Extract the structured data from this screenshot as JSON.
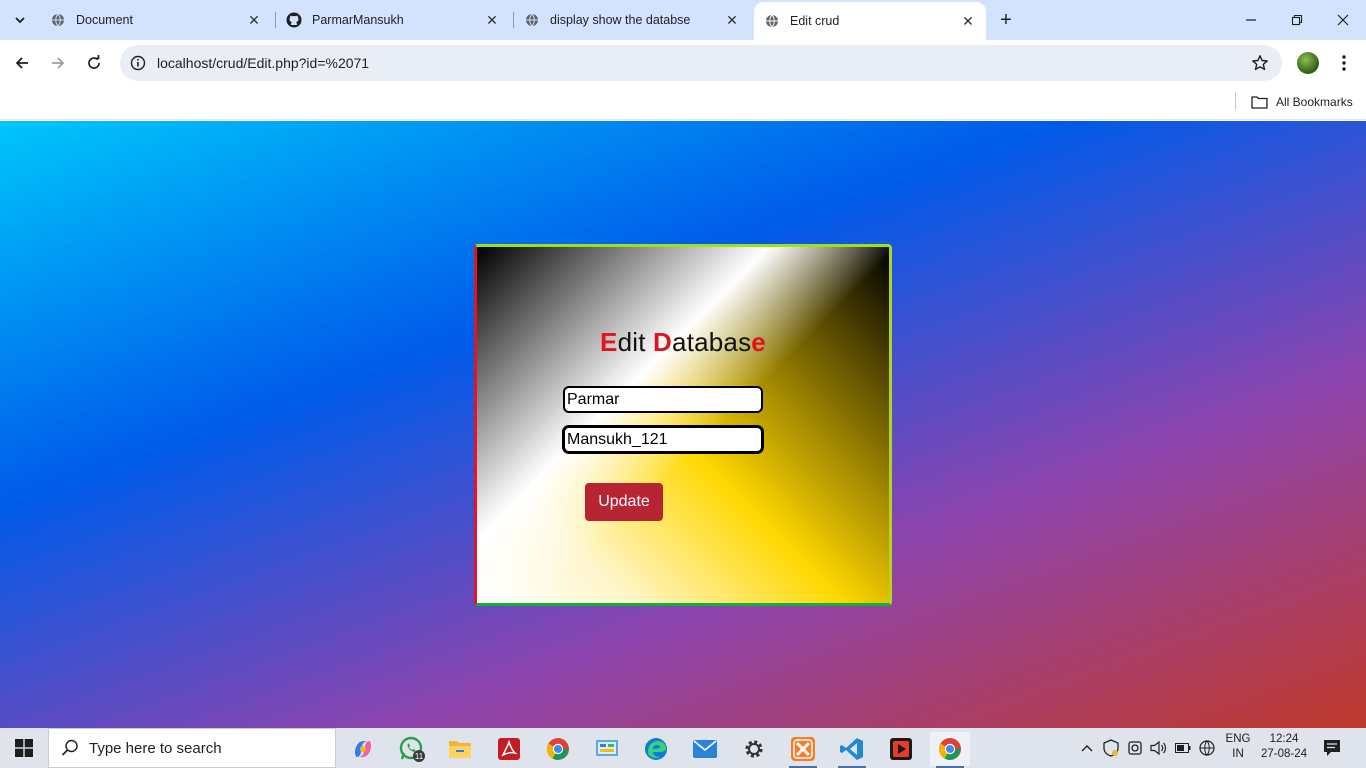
{
  "browser": {
    "tabs": [
      {
        "title": "Document",
        "favicon": "globe-icon",
        "active": false
      },
      {
        "title": "ParmarMansukh",
        "favicon": "github-icon",
        "active": false
      },
      {
        "title": "display show the databse",
        "favicon": "globe-icon",
        "active": false
      },
      {
        "title": "Edit crud",
        "favicon": "globe-icon",
        "active": true
      }
    ],
    "close_glyph": "✕",
    "new_tab_glyph": "+",
    "address": "localhost/crud/Edit.php?id=%2071",
    "bookmarks": {
      "all_label": "All Bookmarks"
    }
  },
  "form": {
    "title_parts": [
      {
        "text": "E",
        "highlight": true
      },
      {
        "text": "dit ",
        "highlight": false
      },
      {
        "text": "D",
        "highlight": true
      },
      {
        "text": "atabas",
        "highlight": false
      },
      {
        "text": "e",
        "highlight": true
      }
    ],
    "first_field_value": "Parmar",
    "second_field_value": "Mansukh_121",
    "update_label": "Update"
  },
  "taskbar": {
    "search_placeholder": "Type here to search",
    "whatsapp_badge": "11",
    "lang_top": "ENG",
    "lang_bottom": "IN",
    "time": "12:24",
    "date": "27-08-24"
  },
  "colors": {
    "title_highlight": "#e0141b",
    "update_button": "#b72433",
    "tabstrip": "#d3e3fd"
  }
}
